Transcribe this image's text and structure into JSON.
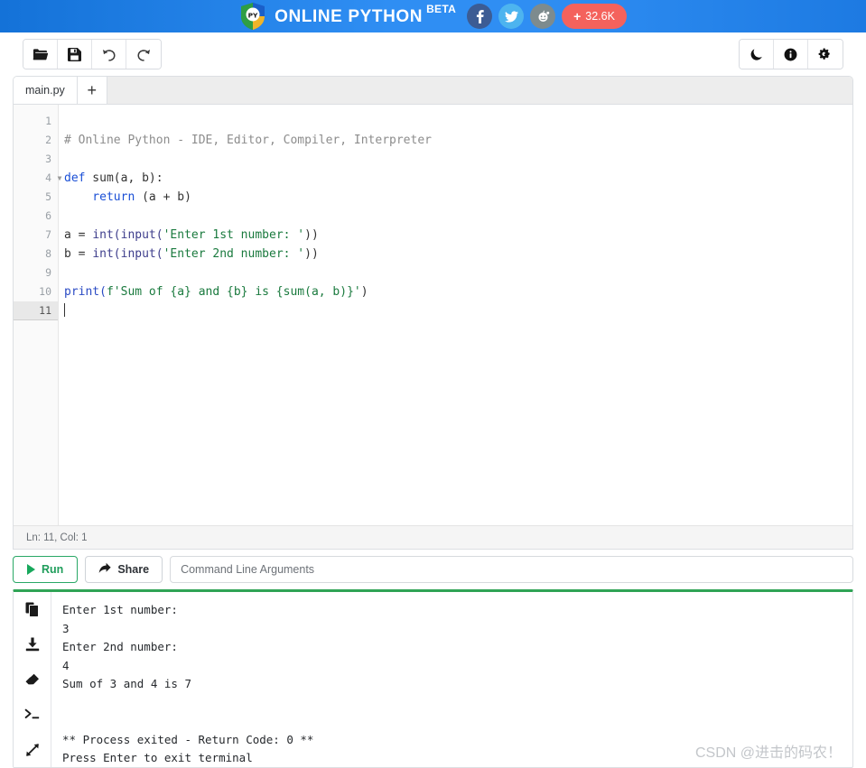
{
  "header": {
    "brand_title": "ONLINE PYTHON",
    "brand_beta": "BETA",
    "logo_text": "PY",
    "socials": [
      {
        "name": "facebook-share-button",
        "label": "f"
      },
      {
        "name": "twitter-share-button",
        "label": "t"
      },
      {
        "name": "reddit-share-button",
        "label": "r"
      }
    ],
    "count_plus": "+",
    "count_label": "32.6K",
    "colors": {
      "gradient_start": "#1472d8",
      "gradient_mid": "#2f8ef3",
      "facebook": "#3c5c94",
      "twitter": "#4db4ef",
      "reddit": "#7d8b8e",
      "count_button": "#f4625c"
    }
  },
  "toolbar": {
    "left_buttons": [
      {
        "icon": "open-folder-icon",
        "label": "Open"
      },
      {
        "icon": "save-icon",
        "label": "Save"
      },
      {
        "icon": "undo-icon",
        "label": "Undo"
      },
      {
        "icon": "redo-icon",
        "label": "Redo"
      }
    ],
    "right_buttons": [
      {
        "icon": "moon-icon",
        "label": "Dark Mode"
      },
      {
        "icon": "info-icon",
        "label": "Info"
      },
      {
        "icon": "settings-gears-icon",
        "label": "Settings"
      }
    ]
  },
  "editor": {
    "tab_name": "main.py",
    "add_tab_label": "+",
    "status": "Ln: 11,  Col: 1",
    "line_numbers": [
      "1",
      "2",
      "3",
      "4",
      "5",
      "6",
      "7",
      "8",
      "9",
      "10",
      "11"
    ],
    "active_line": 11,
    "fold_line": 4,
    "lines": [
      {
        "n": 1,
        "text": ""
      },
      {
        "n": 2,
        "text": "# Online Python - IDE, Editor, Compiler, Interpreter"
      },
      {
        "n": 3,
        "text": ""
      },
      {
        "n": 4,
        "text": "def sum(a, b):"
      },
      {
        "n": 5,
        "text": "    return (a + b)"
      },
      {
        "n": 6,
        "text": ""
      },
      {
        "n": 7,
        "text": "a = int(input('Enter 1st number: '))"
      },
      {
        "n": 8,
        "text": "b = int(input('Enter 2nd number: '))"
      },
      {
        "n": 9,
        "text": ""
      },
      {
        "n": 10,
        "text": "print(f'Sum of {a} and {b} is {sum(a, b)}')"
      },
      {
        "n": 11,
        "text": ""
      }
    ],
    "tokens": {
      "comment": "# Online Python - IDE, Editor, Compiler, Interpreter",
      "kw_def": "def",
      "fn_sum": " sum(a, b):",
      "kw_return": "    return",
      "return_rest": " (a + b)",
      "l7_a": "a = ",
      "l7_int": "int(input(",
      "l7_str": "'Enter 1st number: '",
      "l7_end": "))",
      "l8_a": "b = ",
      "l8_int": "int(input(",
      "l8_str": "'Enter 2nd number: '",
      "l8_end": "))",
      "l10_print": "print(",
      "l10_f": "f'Sum of {a} and {b} is {sum(a, b)}'",
      "l10_end": ")"
    }
  },
  "runbar": {
    "run_label": "Run",
    "share_label": "Share",
    "cla_placeholder": "Command Line Arguments",
    "cla_value": ""
  },
  "output": {
    "sidebar_icons": [
      {
        "name": "copy-icon",
        "label": "Copy"
      },
      {
        "name": "download-icon",
        "label": "Download"
      },
      {
        "name": "eraser-clear-icon",
        "label": "Clear"
      },
      {
        "name": "terminal-prompt-icon",
        "label": "Terminal"
      },
      {
        "name": "expand-fullscreen-icon",
        "label": "Expand"
      }
    ],
    "text": "Enter 1st number:\n3\nEnter 2nd number:\n4\nSum of 3 and 4 is 7\n\n\n** Process exited - Return Code: 0 **\nPress Enter to exit terminal",
    "top_border_color": "#2fa355"
  },
  "watermark": "CSDN @进击的码农！"
}
